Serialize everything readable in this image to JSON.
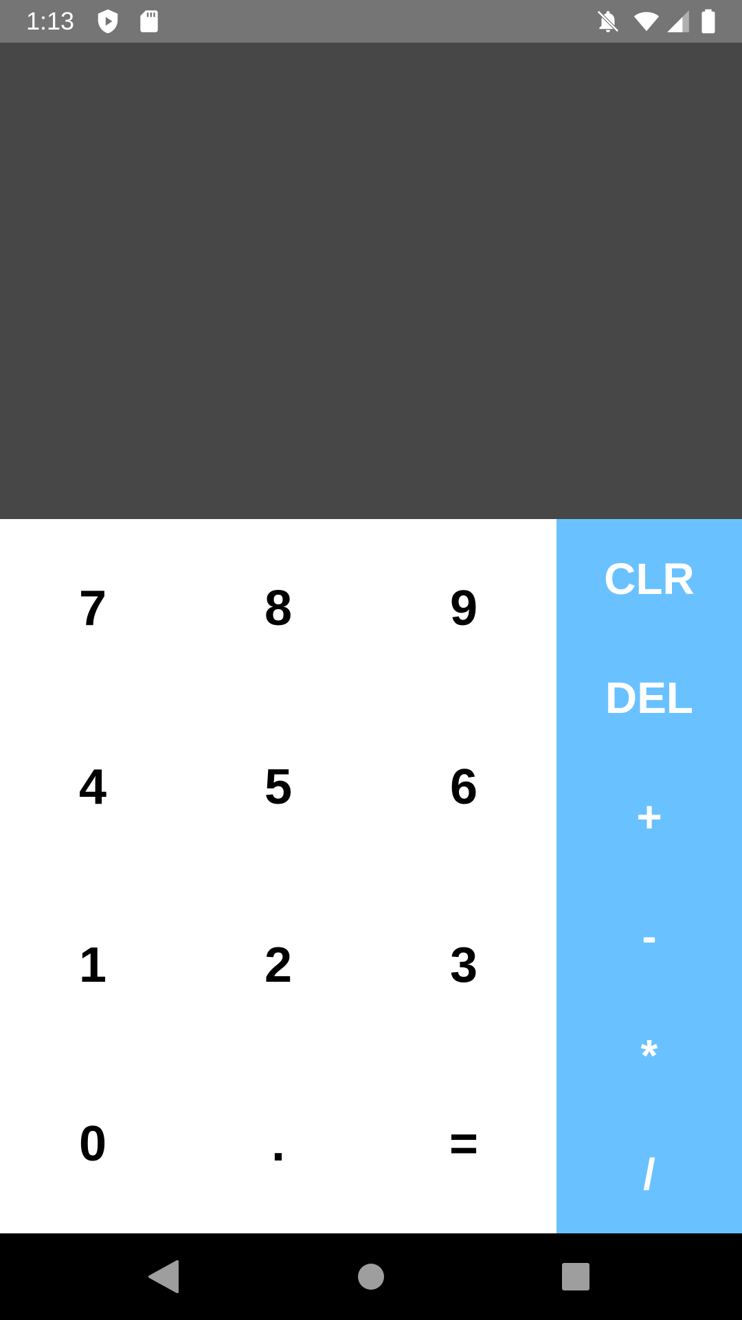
{
  "status_bar": {
    "time": "1:13",
    "icons": [
      "play-protect-icon",
      "sd-card-icon",
      "notifications-off-icon",
      "wifi-icon",
      "cell-signal-icon",
      "battery-icon"
    ],
    "background": "#757575"
  },
  "display": {
    "value": "",
    "background": "#474747"
  },
  "keypad": {
    "keys": [
      "7",
      "8",
      "9",
      "4",
      "5",
      "6",
      "1",
      "2",
      "3",
      "0",
      ".",
      "="
    ]
  },
  "operators": {
    "keys": [
      "CLR",
      "DEL",
      "+",
      "-",
      "*",
      "/"
    ],
    "background": "#69c2ff"
  },
  "nav_bar": {
    "icons": [
      "back-icon",
      "home-icon",
      "recents-icon"
    ]
  }
}
